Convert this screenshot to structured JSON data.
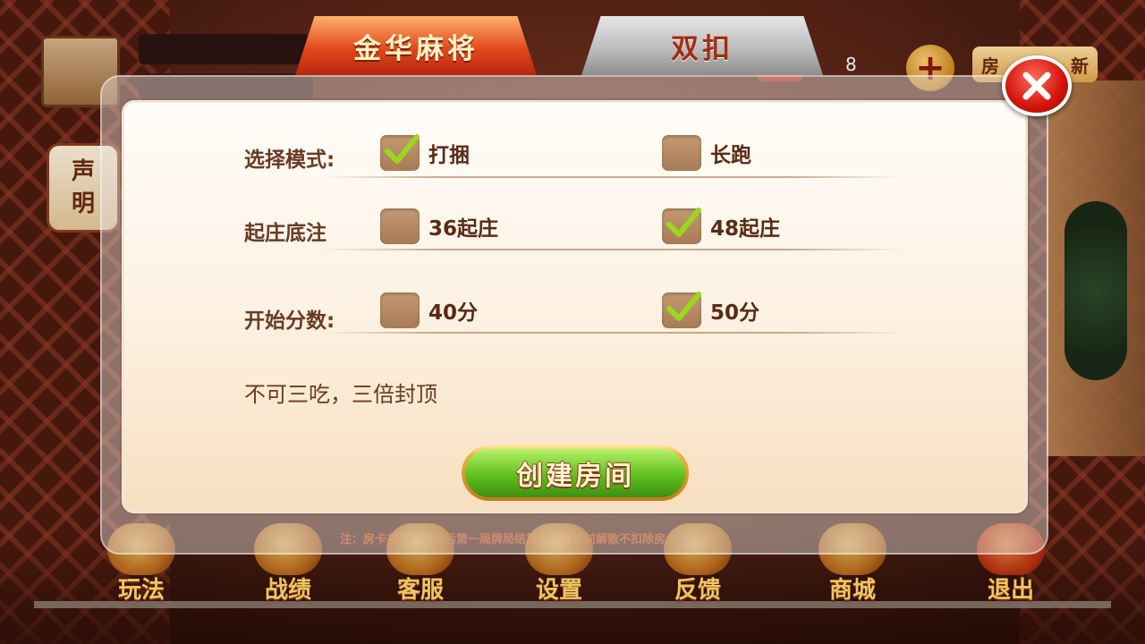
{
  "background": {
    "notice_label": [
      "声",
      "明"
    ],
    "gem_count": "8",
    "plus_icon": "plus-icon",
    "room_chip_left": "房",
    "room_chip_right": "新",
    "small_tag": "房",
    "scroll_notice": "注：房卡在开始游戏后第一局牌局结算后扣除提前解散不扣除房卡",
    "nav": [
      {
        "label": "玩法",
        "icon": "rules-icon"
      },
      {
        "label": "战绩",
        "icon": "record-icon"
      },
      {
        "label": "客服",
        "icon": "service-icon"
      },
      {
        "label": "设置",
        "icon": "settings-icon"
      },
      {
        "label": "反馈",
        "icon": "feedback-icon"
      },
      {
        "label": "商城",
        "icon": "shop-icon"
      },
      {
        "label": "退出",
        "icon": "power-icon"
      }
    ]
  },
  "dialog": {
    "tabs": [
      {
        "label": "金华麻将",
        "active": true
      },
      {
        "label": "双扣",
        "active": false
      }
    ],
    "rows": [
      {
        "label": "选择模式:",
        "options": [
          {
            "text": "打捆",
            "checked": true
          },
          {
            "text": "长跑",
            "checked": false
          }
        ]
      },
      {
        "label": "起庄底注",
        "options": [
          {
            "text": "36起庄",
            "checked": false
          },
          {
            "text": "48起庄",
            "checked": true
          }
        ]
      },
      {
        "label": "开始分数:",
        "options": [
          {
            "text": "40分",
            "checked": false
          },
          {
            "text": "50分",
            "checked": true
          }
        ]
      }
    ],
    "rule_note": "不可三吃，三倍封顶",
    "create_button": "创建房间",
    "close_icon": "close-icon"
  },
  "colors": {
    "active_tab": "#e14a1c",
    "create_button": "#5fbf1e",
    "close_button": "#d3140a",
    "check_mark": "#9ad81e"
  }
}
